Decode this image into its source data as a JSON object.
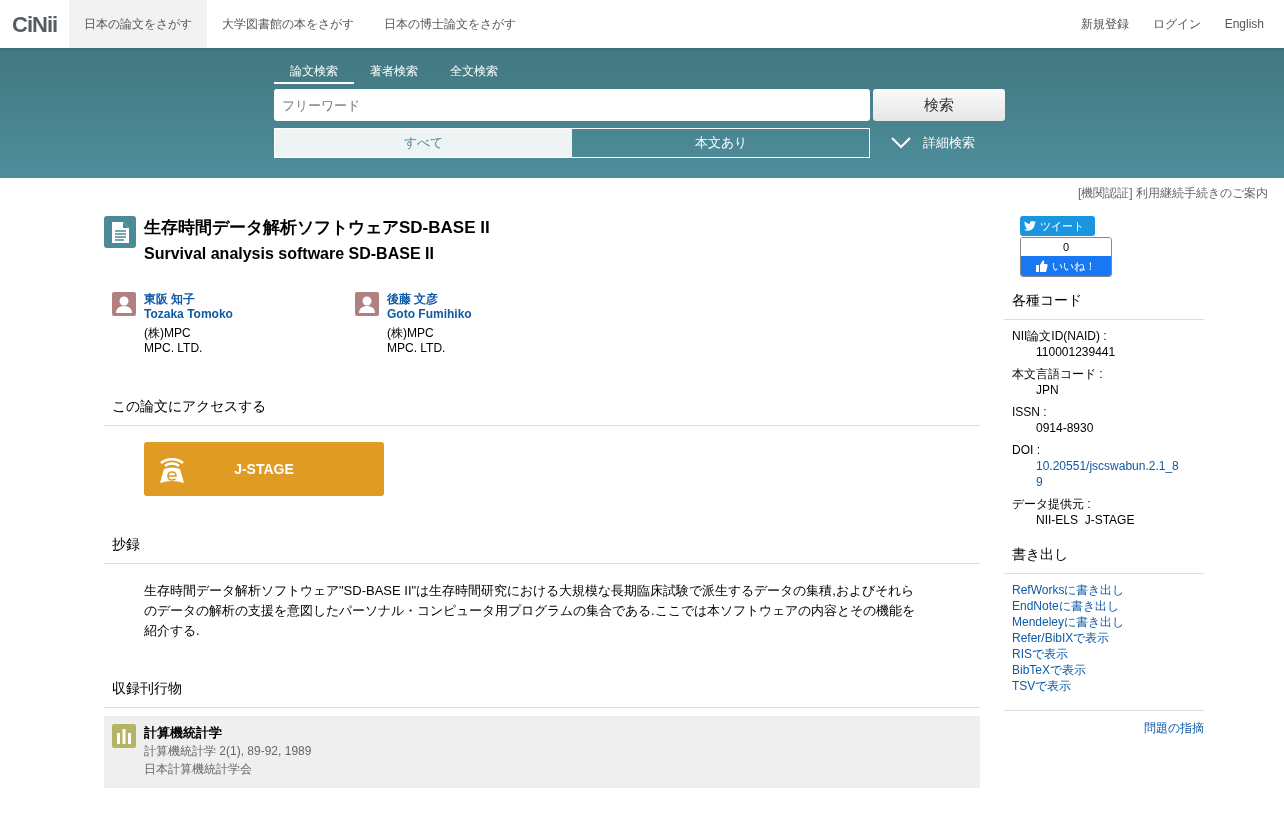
{
  "header": {
    "logo": "CiNii",
    "nav": [
      {
        "label": "日本の論文をさがす",
        "selected": true
      },
      {
        "label": "大学図書館の本をさがす",
        "selected": false
      },
      {
        "label": "日本の博士論文をさがす",
        "selected": false
      }
    ],
    "links": [
      "新規登録",
      "ログイン",
      "English"
    ]
  },
  "search": {
    "tabs": [
      {
        "label": "論文検索",
        "selected": true
      },
      {
        "label": "著者検索",
        "selected": false
      },
      {
        "label": "全文検索",
        "selected": false
      }
    ],
    "placeholder": "フリーワード",
    "button": "検索",
    "filters": [
      {
        "label": "すべて",
        "selected": true
      },
      {
        "label": "本文あり",
        "selected": false
      }
    ],
    "advanced": "詳細検索"
  },
  "notice": "[機関認証] 利用継続手続きのご案内",
  "article": {
    "title": "生存時間データ解析ソフトウェアSD-BASE II",
    "title_en": "Survival analysis software SD-BASE II",
    "authors": [
      {
        "name": "東阪 知子",
        "name_en": "Tozaka Tomoko",
        "affiliation": "(株)MPC",
        "affiliation_en": "MPC. LTD."
      },
      {
        "name": "後藤 文彦",
        "name_en": "Goto Fumihiko",
        "affiliation": "(株)MPC",
        "affiliation_en": "MPC. LTD."
      }
    ],
    "access_heading": "この論文にアクセスする",
    "access_button": "J-STAGE",
    "abstract_heading": "抄録",
    "abstract": "生存時間データ解析ソフトウェア\"SD-BASE II\"は生存時間研究における大規模な長期臨床試験で派生するデータの集積,およびそれらのデータの解析の支援を意図したパーソナル・コンピュータ用プログラムの集合である.ここでは本ソフトウェアの内容とその機能を紹介する.",
    "journal_heading": "収録刊行物",
    "journal": {
      "name": "計算機統計学",
      "citation": "計算機統計学 2(1), 89-92, 1989",
      "publisher": "日本計算機統計学会"
    }
  },
  "sidebar": {
    "tweet": "ツイート",
    "like_count": "0",
    "like": "いいね！",
    "codes_heading": "各種コード",
    "codes": [
      {
        "label": "NII論文ID(NAID) :",
        "value": "110001239441",
        "kind": "text"
      },
      {
        "label": "本文言語コード :",
        "value": "JPN",
        "kind": "text"
      },
      {
        "label": "ISSN :",
        "value": "0914-8930",
        "kind": "text"
      },
      {
        "label": "DOI :",
        "value": "10.20551/jscswabun.2.1_89",
        "kind": "link"
      },
      {
        "label": "データ提供元 :",
        "value": "NII-ELS  J-STAGE",
        "kind": "text"
      }
    ],
    "export_heading": "書き出し",
    "exports": [
      "RefWorksに書き出し",
      "EndNoteに書き出し",
      "Mendeleyに書き出し",
      "Refer/BibIXで表示",
      "RISで表示",
      "BibTeXで表示",
      "TSVで表示"
    ],
    "report": "問題の指摘"
  }
}
